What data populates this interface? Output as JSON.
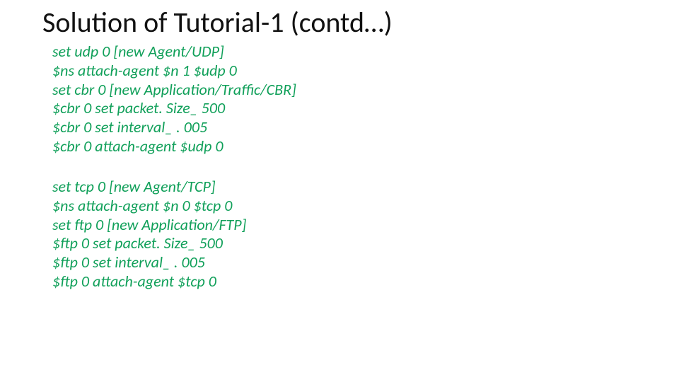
{
  "title": "Solution of Tutorial-1 (contd…)",
  "block1": {
    "l0": "set udp 0 [new Agent/UDP]",
    "l1": "$ns attach-agent $n 1 $udp 0",
    "l2": "set cbr 0 [new Application/Traffic/CBR]",
    "l3": "$cbr 0 set packet. Size_ 500",
    "l4": "$cbr 0 set interval_ . 005",
    "l5": "$cbr 0 attach-agent $udp 0"
  },
  "block2": {
    "l0": "set tcp 0 [new Agent/TCP]",
    "l1": "$ns attach-agent $n 0 $tcp 0",
    "l2": "set ftp 0 [new Application/FTP]",
    "l3": "$ftp 0 set packet. Size_ 500",
    "l4": "$ftp 0 set interval_ . 005",
    "l5": "$ftp 0 attach-agent $tcp 0"
  }
}
